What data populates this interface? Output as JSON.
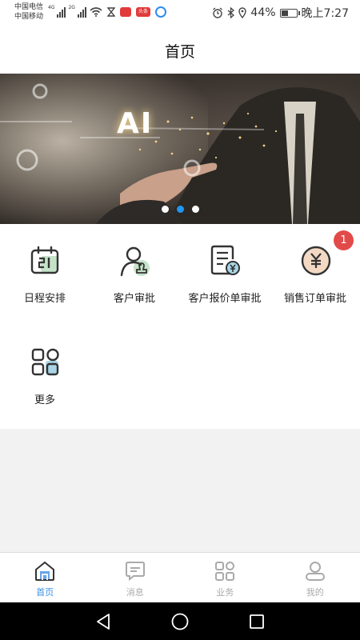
{
  "status_bar": {
    "carrier_1": "中国电信",
    "carrier_2": "中国移动",
    "network_1": "4G",
    "network_2": "2G",
    "app_badge_label": "头条",
    "battery": "44%",
    "time": "晚上7:27"
  },
  "header": {
    "title": "首页"
  },
  "banner": {
    "text": "AI",
    "slide_count": 3,
    "active_slide": 2
  },
  "menu": {
    "items": [
      {
        "label": "日程安排",
        "icon": "calendar-icon"
      },
      {
        "label": "客户审批",
        "icon": "customer-approval-icon"
      },
      {
        "label": "客户报价单审批",
        "icon": "quote-approval-icon"
      },
      {
        "label": "销售订单审批",
        "icon": "sales-order-icon"
      },
      {
        "label": "更多",
        "icon": "more-grid-icon"
      }
    ],
    "sales_order_badge": "1"
  },
  "tab_bar": {
    "tabs": [
      {
        "label": "首页",
        "icon": "home-icon",
        "active": true
      },
      {
        "label": "消息",
        "icon": "message-icon",
        "active": false
      },
      {
        "label": "业务",
        "icon": "business-grid-icon",
        "active": false
      },
      {
        "label": "我的",
        "icon": "profile-icon",
        "active": false
      }
    ]
  },
  "colors": {
    "accent": "#3a8ee6",
    "icon_green": "#c5e3c8",
    "icon_blue": "#a9d5e6",
    "icon_tan": "#f3d9c4",
    "badge": "#e24a4a"
  }
}
